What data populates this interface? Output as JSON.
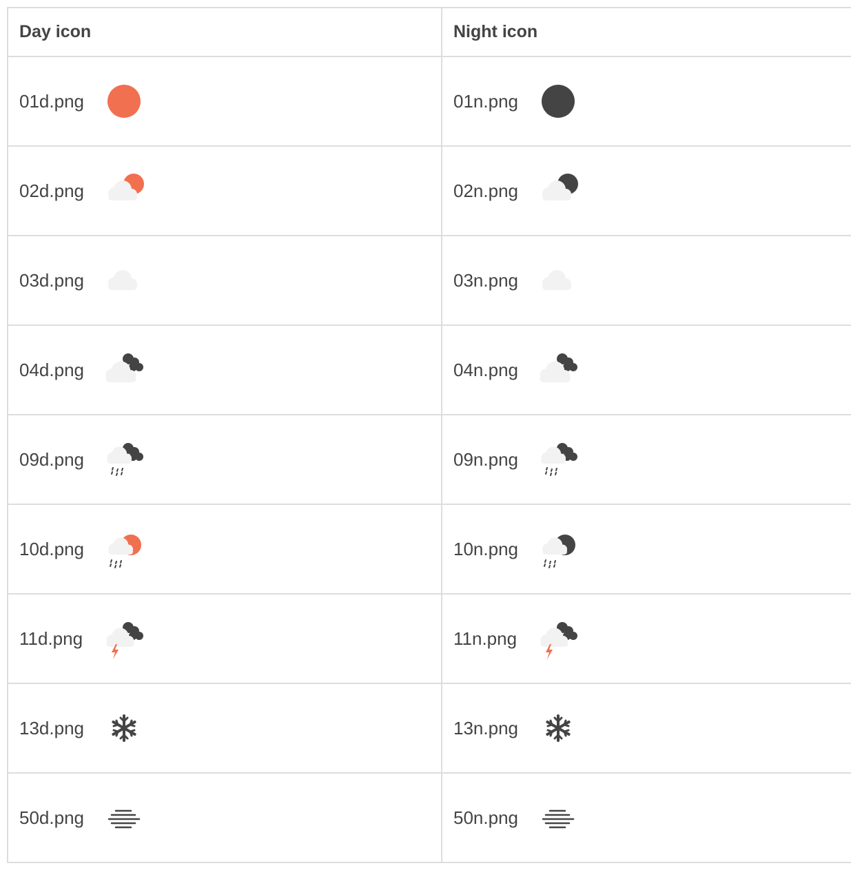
{
  "table": {
    "headers": {
      "day": "Day icon",
      "night": "Night icon"
    },
    "rows": [
      {
        "day": {
          "file": "01d.png",
          "icon": "clear-sky-day-icon"
        },
        "night": {
          "file": "01n.png",
          "icon": "clear-sky-night-icon"
        }
      },
      {
        "day": {
          "file": "02d.png",
          "icon": "few-clouds-day-icon"
        },
        "night": {
          "file": "02n.png",
          "icon": "few-clouds-night-icon"
        }
      },
      {
        "day": {
          "file": "03d.png",
          "icon": "scattered-clouds-icon"
        },
        "night": {
          "file": "03n.png",
          "icon": "scattered-clouds-icon"
        }
      },
      {
        "day": {
          "file": "04d.png",
          "icon": "broken-clouds-icon"
        },
        "night": {
          "file": "04n.png",
          "icon": "broken-clouds-icon"
        }
      },
      {
        "day": {
          "file": "09d.png",
          "icon": "shower-rain-icon"
        },
        "night": {
          "file": "09n.png",
          "icon": "shower-rain-icon"
        }
      },
      {
        "day": {
          "file": "10d.png",
          "icon": "rain-day-icon"
        },
        "night": {
          "file": "10n.png",
          "icon": "rain-night-icon"
        }
      },
      {
        "day": {
          "file": "11d.png",
          "icon": "thunderstorm-icon"
        },
        "night": {
          "file": "11n.png",
          "icon": "thunderstorm-icon"
        }
      },
      {
        "day": {
          "file": "13d.png",
          "icon": "snow-icon"
        },
        "night": {
          "file": "13n.png",
          "icon": "snow-icon"
        }
      },
      {
        "day": {
          "file": "50d.png",
          "icon": "mist-icon"
        },
        "night": {
          "file": "50n.png",
          "icon": "mist-icon"
        }
      }
    ]
  },
  "colors": {
    "sun": "#f07050",
    "dark": "#444444",
    "cloud": "#f2f2f2",
    "border": "#dddddd"
  }
}
